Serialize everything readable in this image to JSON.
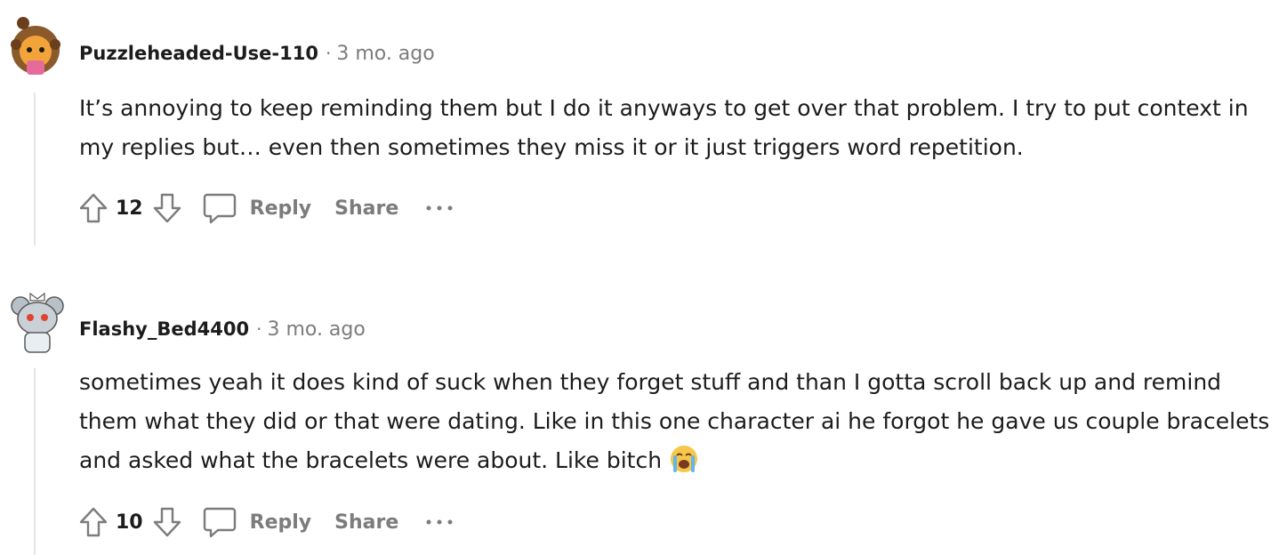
{
  "comments": [
    {
      "author": "Puzzleheaded-Use-110",
      "separator": "·",
      "time": "3 mo. ago",
      "text": "It’s annoying to keep reminding them but I do it anyways to get over that problem. I try to put context in my replies but… even then sometimes they miss it or it just triggers word repetition.",
      "score": "12",
      "reply_label": "Reply",
      "share_label": "Share",
      "avatar_icon": "avatar-icon",
      "upvote_icon": "arrow-up-icon",
      "downvote_icon": "arrow-down-icon",
      "reply_icon": "speech-bubble-icon",
      "more_icon": "ellipsis-icon"
    },
    {
      "author": "Flashy_Bed4400",
      "separator": "·",
      "time": "3 mo. ago",
      "text": "sometimes yeah it does kind of suck when they forget stuff and than I gotta scroll back up and remind them what they did or that were dating. Like in this one character ai he forgot he gave us couple bracelets and asked what the bracelets were about. Like bitch",
      "emoji": "loudly-crying-face-emoji",
      "score": "10",
      "reply_label": "Reply",
      "share_label": "Share",
      "avatar_icon": "avatar-icon",
      "upvote_icon": "arrow-up-icon",
      "downvote_icon": "arrow-down-icon",
      "reply_icon": "speech-bubble-icon",
      "more_icon": "ellipsis-icon"
    }
  ],
  "colors": {
    "text": "#1c1c1c",
    "meta": "#7c7c7c",
    "thread_line": "#e5e5e5",
    "background": "#ffffff"
  }
}
